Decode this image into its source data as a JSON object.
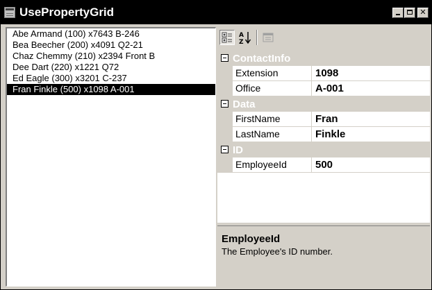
{
  "window": {
    "title": "UsePropertyGrid"
  },
  "employees": [
    "Abe Armand (100) x7643 B-246",
    "Bea Beecher (200) x4091 Q2-21",
    "Chaz Chemmy (210) x2394 Front B",
    "Dee Dart (220) x1221 Q72",
    "Ed Eagle (300) x3201 C-237",
    "Fran Finkle (500) x1098 A-001"
  ],
  "selected_index": 5,
  "toolbar": {
    "buttons": [
      {
        "icon": "categorized-icon",
        "pressed": true
      },
      {
        "icon": "alphabetical-sort-icon",
        "pressed": false
      },
      {
        "icon": "property-pages-icon",
        "pressed": false,
        "enabled": false
      }
    ]
  },
  "property_grid": {
    "categories": [
      {
        "name": "ContactInfo",
        "properties": [
          {
            "name": "Extension",
            "value": "1098"
          },
          {
            "name": "Office",
            "value": "A-001"
          }
        ]
      },
      {
        "name": "Data",
        "properties": [
          {
            "name": "FirstName",
            "value": "Fran"
          },
          {
            "name": "LastName",
            "value": "Finkle"
          }
        ]
      },
      {
        "name": "ID",
        "properties": [
          {
            "name": "EmployeeId",
            "value": "500"
          }
        ]
      }
    ]
  },
  "description": {
    "title": "EmployeeId",
    "text": "The Employee's ID number."
  }
}
